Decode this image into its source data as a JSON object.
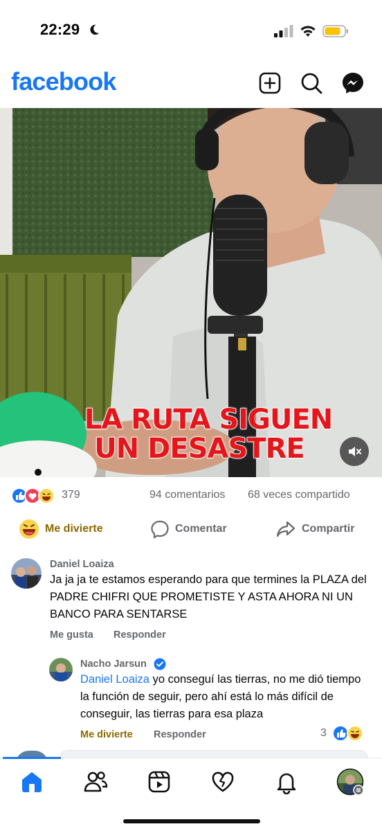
{
  "status": {
    "time": "22:29"
  },
  "header": {
    "logo": "facebook",
    "icons": [
      "plus-square-icon",
      "search-icon",
      "messenger-icon"
    ],
    "brand_color": "#1877f2"
  },
  "post": {
    "video_caption_line1": "LA RUTA SIGUEN",
    "video_caption_line2": "UN DESASTRE",
    "reaction_count": "379",
    "comments_count": "94 comentarios",
    "shares_count": "68 veces compartido",
    "actions": {
      "react": "Me divierte",
      "comment": "Comentar",
      "share": "Compartir"
    }
  },
  "comments": [
    {
      "author": "Daniel Loaiza",
      "text": "Ja ja ja te estamos esperando para que termines la PLAZA del PADRE CHIFRI QUE PROMETISTE Y ASTA AHORA NI UN BANCO PARA SENTARSE",
      "like": "Me gusta",
      "reply": "Responder"
    },
    {
      "author": "Nacho Jarsun",
      "mention": "Daniel Loaiza",
      "text": " yo conseguí las tierras, no me dió tiempo la función de seguir, pero ahí está lo más difícil de conseguir, las tierras para esa plaza",
      "react": "Me divierte",
      "reply": "Responder",
      "reaction_count": "3"
    }
  ],
  "bottom_nav": [
    "home-icon",
    "friends-icon",
    "reels-icon",
    "dating-heart-icon",
    "notifications-bell-icon",
    "profile-avatar"
  ]
}
